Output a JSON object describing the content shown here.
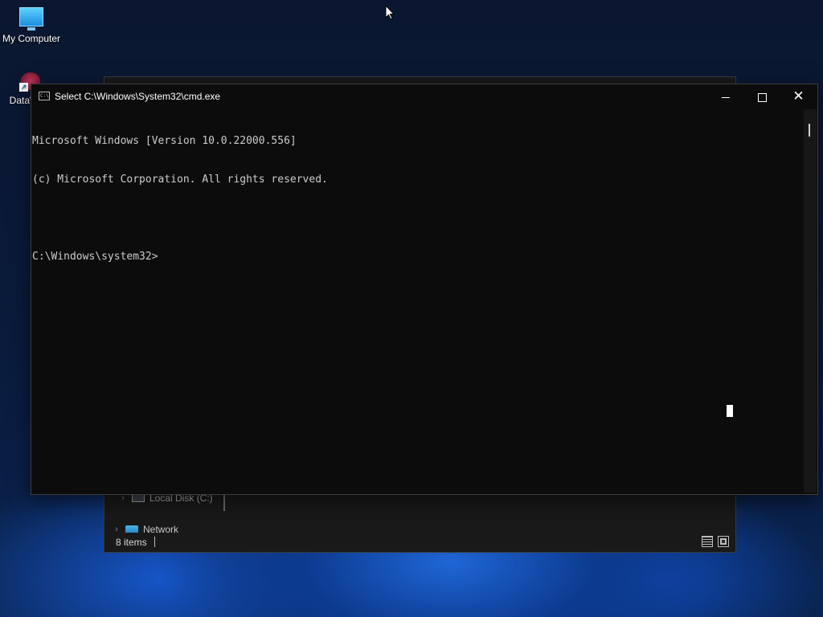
{
  "desktop": {
    "icons": [
      {
        "label": "My Computer",
        "icon": "computer-icon"
      },
      {
        "label": "DataW",
        "icon": "datawarrior-icon"
      }
    ]
  },
  "explorer": {
    "nav": {
      "local_disk_label": "Local Disk (C:)",
      "network_label": "Network"
    },
    "status": {
      "item_count": "8 items"
    },
    "view_buttons": [
      "details-view-icon",
      "large-icons-view-icon"
    ]
  },
  "cmd": {
    "title": "Select C:\\Windows\\System32\\cmd.exe",
    "lines": [
      "Microsoft Windows [Version 10.0.22000.556]",
      "(c) Microsoft Corporation. All rights reserved.",
      "",
      "C:\\Windows\\system32>"
    ],
    "icons": {
      "minimize": "minimize-icon",
      "maximize": "maximize-icon",
      "close": "close-icon"
    },
    "colors": {
      "background": "#0c0c0c",
      "text": "#cccccc"
    }
  }
}
